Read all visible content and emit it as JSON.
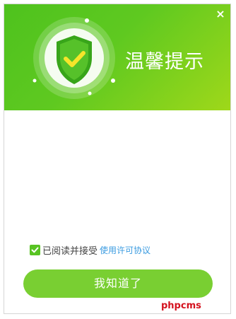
{
  "dialog": {
    "title": "温馨提示",
    "close_label": "×",
    "agree_text": "已阅读并接受",
    "license_link": "使用许可协议",
    "agree_checked": true,
    "ok_button": "我知道了"
  },
  "watermark": "phpcms",
  "colors": {
    "header_gradient_start": "#4ec21e",
    "header_gradient_end": "#9fd81a",
    "button": "#79cf32",
    "link": "#3a9be0",
    "shield_check": "#f5e52a"
  },
  "icons": {
    "emblem": "shield-check-icon",
    "close": "close-icon",
    "checkbox": "check-icon"
  }
}
